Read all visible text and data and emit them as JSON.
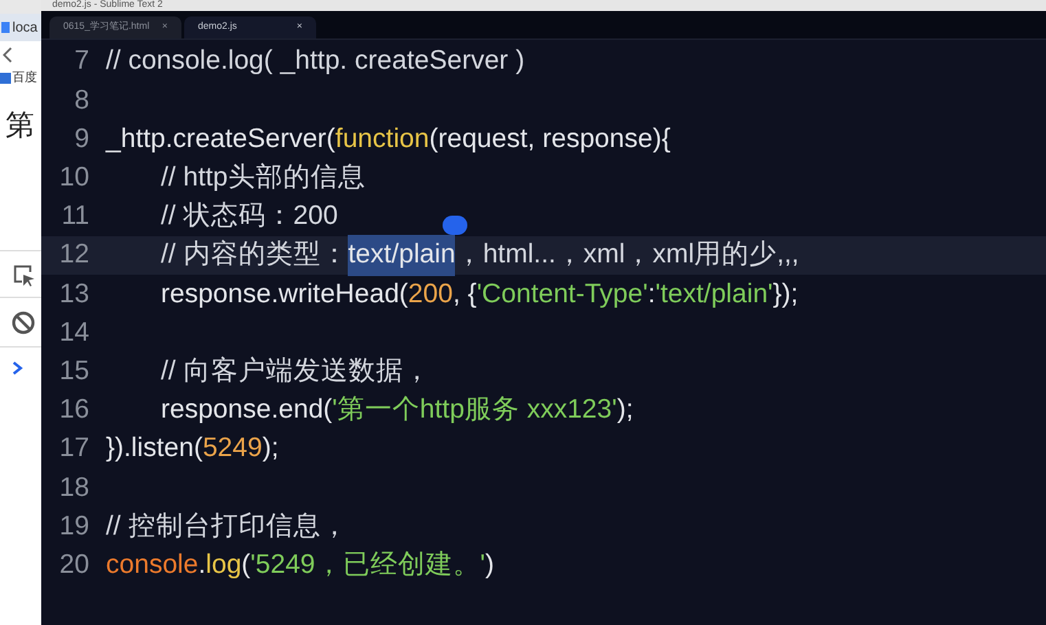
{
  "browser": {
    "tab": "loca",
    "bookmark": "百度",
    "heading": "第"
  },
  "editor": {
    "title": "demo2.js - Sublime Text 2",
    "tabs": [
      {
        "label": "0615_学习笔记.html",
        "close": "×",
        "selected": false
      },
      {
        "label": "demo2.js",
        "close": "×",
        "selected": true
      }
    ],
    "lines": [
      {
        "number": "7",
        "current": false,
        "indent": false,
        "tokens": [
          {
            "kind": "comment",
            "text": "// console.log( _http. createServer )"
          }
        ]
      },
      {
        "number": "8",
        "current": false
      },
      {
        "number": "9",
        "current": false,
        "indent": false,
        "tokens": [
          {
            "kind": "plain",
            "text": "_http.createServer("
          },
          {
            "kind": "keyword",
            "text": "function"
          },
          {
            "kind": "plain",
            "text": "(request, response){"
          }
        ]
      },
      {
        "number": "10",
        "current": false,
        "indent": true,
        "tokens": [
          {
            "kind": "comment",
            "text": "// http头部的信息"
          }
        ]
      },
      {
        "number": "11",
        "current": false,
        "indent": true,
        "tokens": [
          {
            "kind": "comment",
            "text": "// 状态码：200"
          }
        ]
      },
      {
        "number": "12",
        "current": true,
        "indent": true,
        "tokens": [
          {
            "kind": "comment",
            "text": "// 内容的类型："
          },
          {
            "kind": "selected",
            "text": "text/plain"
          },
          {
            "kind": "comment",
            "text": "，html...，xml，xml用的少,,,"
          }
        ]
      },
      {
        "number": "13",
        "current": false,
        "indent": true,
        "tokens": [
          {
            "kind": "plain",
            "text": "response.writeHead("
          },
          {
            "kind": "number",
            "text": "200"
          },
          {
            "kind": "plain",
            "text": ", {"
          },
          {
            "kind": "string",
            "text": "'Content-Type'"
          },
          {
            "kind": "plain",
            "text": ":"
          },
          {
            "kind": "string",
            "text": "'text/plain'"
          },
          {
            "kind": "plain",
            "text": "});"
          }
        ]
      },
      {
        "number": "14",
        "current": false
      },
      {
        "number": "15",
        "current": false,
        "indent": true,
        "tokens": [
          {
            "kind": "comment",
            "text": "// 向客户端发送数据，"
          }
        ]
      },
      {
        "number": "16",
        "current": false,
        "indent": true,
        "tokens": [
          {
            "kind": "plain",
            "text": "response.end("
          },
          {
            "kind": "string",
            "text": "'第一个http服务 xxx123'"
          },
          {
            "kind": "plain",
            "text": ");"
          }
        ]
      },
      {
        "number": "17",
        "current": false,
        "indent": false,
        "tokens": [
          {
            "kind": "plain",
            "text": "}).listen("
          },
          {
            "kind": "number",
            "text": "5249"
          },
          {
            "kind": "plain",
            "text": ");"
          }
        ]
      },
      {
        "number": "18",
        "current": false
      },
      {
        "number": "19",
        "current": false,
        "indent": false,
        "tokens": [
          {
            "kind": "comment",
            "text": "// 控制台打印信息，"
          }
        ]
      },
      {
        "number": "20",
        "current": false,
        "indent": false,
        "tokens": [
          {
            "kind": "builtin",
            "text": "console"
          },
          {
            "kind": "plain",
            "text": "."
          },
          {
            "kind": "keyword",
            "text": "log"
          },
          {
            "kind": "plain",
            "text": "( "
          },
          {
            "kind": "string",
            "text": "'5249，已经创建。'"
          },
          {
            "kind": "plain",
            "text": " )"
          }
        ]
      }
    ]
  }
}
